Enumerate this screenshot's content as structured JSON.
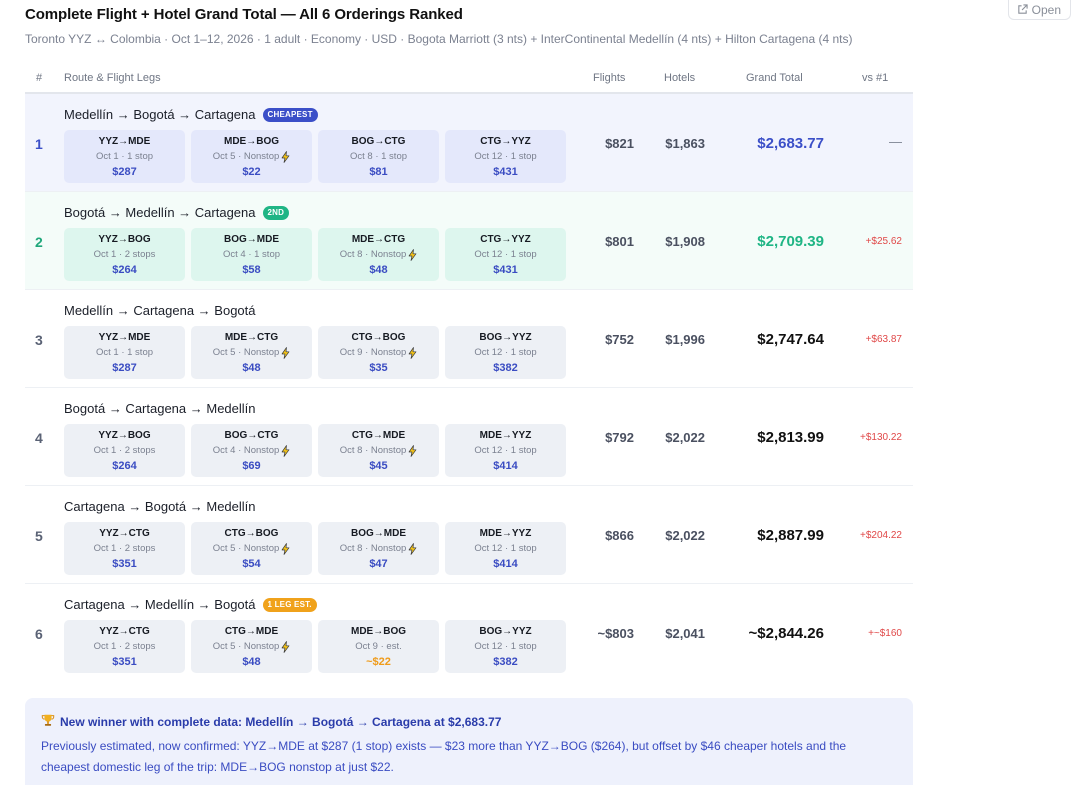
{
  "header": {
    "open_label": "Open",
    "title": "Complete Flight + Hotel Grand Total — All 6 Orderings Ranked",
    "subtitle": "Toronto YYZ ↔ Colombia · Oct 1–12, 2026 · 1 adult · Economy · USD · Bogota Marriott (3 nts) + InterContinental Medellín (4 nts) + Hilton Cartagena (4 nts)"
  },
  "columns": {
    "num": "#",
    "route": "Route & Flight Legs",
    "flights": "Flights",
    "hotels": "Hotels",
    "total": "Grand Total",
    "vs": "vs #1"
  },
  "rows": [
    {
      "rank": "1",
      "route": "Medellín → Bogotá → Cartagena",
      "badge": "CHEAPEST",
      "legs": [
        {
          "code": "YYZ→MDE",
          "detail": "Oct 1 · 1 stop",
          "price": "$287"
        },
        {
          "code": "MDE→BOG",
          "detail": "Oct 5 · Nonstop",
          "price": "$22"
        },
        {
          "code": "BOG→CTG",
          "detail": "Oct 8 · 1 stop",
          "price": "$81"
        },
        {
          "code": "CTG→YYZ",
          "detail": "Oct 12 · 1 stop",
          "price": "$431"
        }
      ],
      "flights": "$821",
      "hotels": "$1,863",
      "total": "$2,683.77",
      "vs": "—"
    },
    {
      "rank": "2",
      "route": "Bogotá → Medellín → Cartagena",
      "badge": "2ND",
      "legs": [
        {
          "code": "YYZ→BOG",
          "detail": "Oct 1 · 2 stops",
          "price": "$264"
        },
        {
          "code": "BOG→MDE",
          "detail": "Oct 4 · 1 stop",
          "price": "$58"
        },
        {
          "code": "MDE→CTG",
          "detail": "Oct 8 · Nonstop",
          "price": "$48"
        },
        {
          "code": "CTG→YYZ",
          "detail": "Oct 12 · 1 stop",
          "price": "$431"
        }
      ],
      "flights": "$801",
      "hotels": "$1,908",
      "total": "$2,709.39",
      "vs": "+$25.62"
    },
    {
      "rank": "3",
      "route": "Medellín → Cartagena → Bogotá",
      "badge": "",
      "legs": [
        {
          "code": "YYZ→MDE",
          "detail": "Oct 1 · 1 stop",
          "price": "$287"
        },
        {
          "code": "MDE→CTG",
          "detail": "Oct 5 · Nonstop",
          "price": "$48"
        },
        {
          "code": "CTG→BOG",
          "detail": "Oct 9 · Nonstop",
          "price": "$35"
        },
        {
          "code": "BOG→YYZ",
          "detail": "Oct 12 · 1 stop",
          "price": "$382"
        }
      ],
      "flights": "$752",
      "hotels": "$1,996",
      "total": "$2,747.64",
      "vs": "+$63.87"
    },
    {
      "rank": "4",
      "route": "Bogotá → Cartagena → Medellín",
      "badge": "",
      "legs": [
        {
          "code": "YYZ→BOG",
          "detail": "Oct 1 · 2 stops",
          "price": "$264"
        },
        {
          "code": "BOG→CTG",
          "detail": "Oct 4 · Nonstop",
          "price": "$69"
        },
        {
          "code": "CTG→MDE",
          "detail": "Oct 8 · Nonstop",
          "price": "$45"
        },
        {
          "code": "MDE→YYZ",
          "detail": "Oct 12 · 1 stop",
          "price": "$414"
        }
      ],
      "flights": "$792",
      "hotels": "$2,022",
      "total": "$2,813.99",
      "vs": "+$130.22"
    },
    {
      "rank": "5",
      "route": "Cartagena → Bogotá → Medellín",
      "badge": "",
      "legs": [
        {
          "code": "YYZ→CTG",
          "detail": "Oct 1 · 2 stops",
          "price": "$351"
        },
        {
          "code": "CTG→BOG",
          "detail": "Oct 5 · Nonstop",
          "price": "$54"
        },
        {
          "code": "BOG→MDE",
          "detail": "Oct 8 · Nonstop",
          "price": "$47"
        },
        {
          "code": "MDE→YYZ",
          "detail": "Oct 12 · 1 stop",
          "price": "$414"
        }
      ],
      "flights": "$866",
      "hotels": "$2,022",
      "total": "$2,887.99",
      "vs": "+$204.22"
    },
    {
      "rank": "6",
      "route": "Cartagena → Medellín → Bogotá",
      "badge": "1 LEG EST.",
      "legs": [
        {
          "code": "YYZ→CTG",
          "detail": "Oct 1 · 2 stops",
          "price": "$351"
        },
        {
          "code": "CTG→MDE",
          "detail": "Oct 5 · Nonstop",
          "price": "$48"
        },
        {
          "code": "MDE→BOG",
          "detail": "Oct 9 · est.",
          "price": "~$22"
        },
        {
          "code": "BOG→YYZ",
          "detail": "Oct 12 · 1 stop",
          "price": "$382"
        }
      ],
      "flights": "~$803",
      "hotels": "$2,041",
      "total": "~$2,844.26",
      "vs": "+~$160"
    }
  ],
  "note": {
    "icon": "trophy-icon",
    "headline": "New winner with complete data: Medellín → Bogotá → Cartagena at $2,683.77",
    "body": "Previously estimated, now confirmed: YYZ→MDE at $287 (1 stop) exists — $23 more than YYZ→BOG ($264), but offset by $46 cheaper hotels and the cheapest domestic leg of the trip: MDE→BOG nonstop at just $22."
  },
  "colors": {
    "accent_blue": "#3b4fc8",
    "accent_green": "#1fb585",
    "estimate_amber": "#f0a21b",
    "delta_red": "#e04848"
  }
}
